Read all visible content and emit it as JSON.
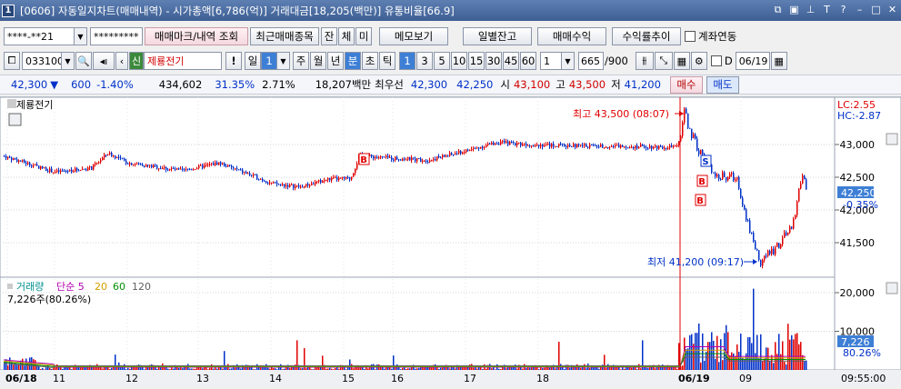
{
  "title": {
    "num": "1",
    "text": "[0606] 자동일지차트(매매내역) - 시가총액[6,786(억)] 거래대금[18,205(백만)] 유통비율[66.9]"
  },
  "toolbar1": {
    "account": "****-**21",
    "password": "*********",
    "mark_btn": "매매마크/내역 조회",
    "recent_btn": "최근매매종목",
    "jan": "잔",
    "che": "체",
    "mi": "미",
    "memo_btn": "메모보기",
    "daily_btn": "일별잔고",
    "profit_btn": "매매수익",
    "rate_btn": "수익률추이",
    "link_label": "계좌연동"
  },
  "toolbar2": {
    "code": "033100",
    "stock_name": "제룡전기",
    "period": "일",
    "period_num": "1",
    "periods": [
      "주",
      "월",
      "년",
      "분",
      "초",
      "틱"
    ],
    "minutes": [
      "1",
      "3",
      "5",
      "10",
      "15",
      "30",
      "45",
      "60"
    ],
    "count_val": "1",
    "bars": "665",
    "bars_total": "/900",
    "d_label": "D",
    "date": "06/19"
  },
  "quote": {
    "price": "42,300",
    "change": "600",
    "pct": "-1.40%",
    "volume": "434,602",
    "vol_rate": "31.35%",
    "turnover_rate": "2.71%",
    "amount": "18,207백만",
    "best_label": "최우선",
    "ask": "42,300",
    "bid": "42,250",
    "open_label": "시",
    "open": "43,100",
    "high_label": "고",
    "high": "43,500",
    "low_label": "저",
    "low": "41,200",
    "buy_btn": "매수",
    "sell_btn": "매도"
  },
  "chart": {
    "name_tag": "제룡전기",
    "lc": "LC:2.55",
    "hc": "HC:-2.87",
    "high_note": "최고 43,500 (08:07)",
    "low_note": "최저 41,200 (09:17)",
    "cur_price": "42,250",
    "cur_pct": "-0.35%",
    "vol_legend": {
      "label": "거래량",
      "ma_label": "단순",
      "ma": [
        "5",
        "20",
        "60",
        "120"
      ],
      "summary": "7,226주(80.26%)"
    },
    "cur_vol": "7,226",
    "cur_vol_pct": "80.26%",
    "x_labels": [
      "06/18",
      "11",
      "12",
      "13",
      "14",
      "15",
      "16",
      "17",
      "18",
      "06/19",
      "09"
    ],
    "time": "09:55:00",
    "markers": [
      "B",
      "S",
      "B",
      "B"
    ]
  },
  "chart_data": {
    "type": "candlestick",
    "price_axis": {
      "ticks": [
        43000,
        42500,
        42000,
        41500
      ]
    },
    "volume_axis": {
      "ticks": [
        20000,
        10000
      ]
    },
    "high": 43500,
    "low": 41200,
    "last": 42250,
    "colors": {
      "up": "#e00000",
      "down": "#0030c8",
      "ma5": "#b000b0",
      "ma20": "#d0a000",
      "ma60": "#009000",
      "ma120": "#606060"
    }
  }
}
